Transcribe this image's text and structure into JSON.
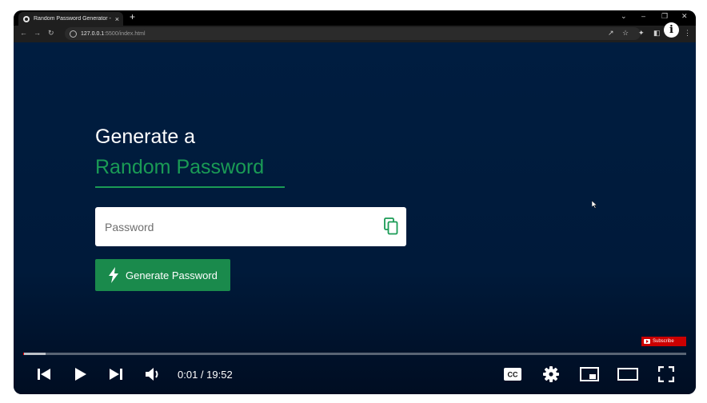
{
  "browser": {
    "tab_title": "Random Password Generator - L",
    "tab_close": "×",
    "new_tab": "+",
    "url_host": "127.0.0.1",
    "url_path": ":5500/index.html"
  },
  "page": {
    "heading_line1": "Generate a",
    "heading_line2": "Random Password",
    "password_placeholder": "Password",
    "generate_button_label": "Generate Password"
  },
  "player": {
    "subscribe_label": "Subscribe",
    "current_time": "0:01",
    "duration": "19:52",
    "time_separator": " / ",
    "progress_fraction": 0.0008,
    "buffered_fraction": 0.034
  },
  "colors": {
    "accent_green": "#1a9b55",
    "button_green": "#1a8a4c",
    "page_background": "#001d40"
  }
}
